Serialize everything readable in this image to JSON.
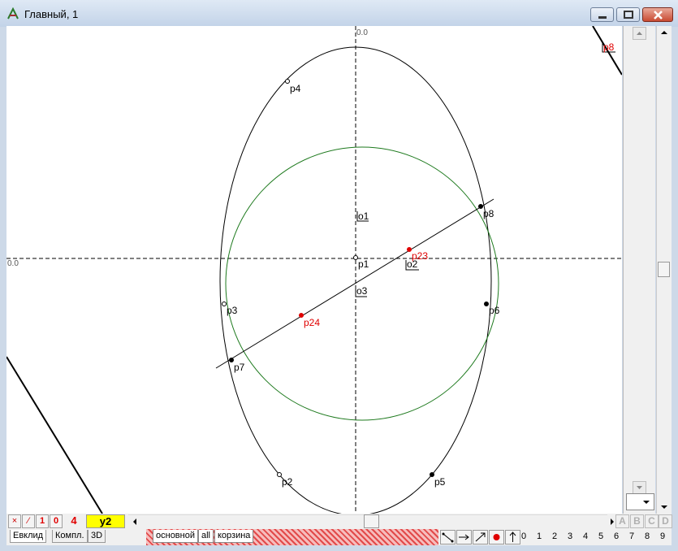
{
  "window": {
    "title": "Главный, 1"
  },
  "canvas": {
    "axis_x_label": "0.0",
    "axis_y_label": "0.0",
    "points": [
      {
        "id": "p1",
        "label": "p1",
        "color": "#000000"
      },
      {
        "id": "p2",
        "label": "p2",
        "color": "#000000"
      },
      {
        "id": "p3",
        "label": "p3",
        "color": "#000000"
      },
      {
        "id": "p4",
        "label": "p4",
        "color": "#000000"
      },
      {
        "id": "p5",
        "label": "p5",
        "color": "#000000"
      },
      {
        "id": "p6",
        "label": "p6",
        "color": "#000000"
      },
      {
        "id": "p7",
        "label": "p7",
        "color": "#000000"
      },
      {
        "id": "p8",
        "label": "p8",
        "color": "#000000"
      },
      {
        "id": "p23",
        "label": "p23",
        "color": "#e00000"
      },
      {
        "id": "p24",
        "label": "p24",
        "color": "#e00000"
      }
    ],
    "objects": {
      "o1": "o1",
      "o2": "o2",
      "o3": "o3"
    },
    "offscreen_label": "p8",
    "circle_color": "#1e7a1e"
  },
  "toolbar": {
    "tool_x": "×",
    "tool_slash": "⁄",
    "tool_1": "1",
    "tool_0": "0",
    "tool_4": "4",
    "layer_name": "y2",
    "abcd": [
      "A",
      "B",
      "C",
      "D"
    ]
  },
  "tabs": {
    "mode": [
      "Евклид",
      "Компл.",
      "3D"
    ],
    "layers": [
      "основной",
      "all",
      "корзина"
    ]
  },
  "digits": [
    "0",
    "1",
    "2",
    "3",
    "4",
    "5",
    "6",
    "7",
    "8",
    "9"
  ]
}
